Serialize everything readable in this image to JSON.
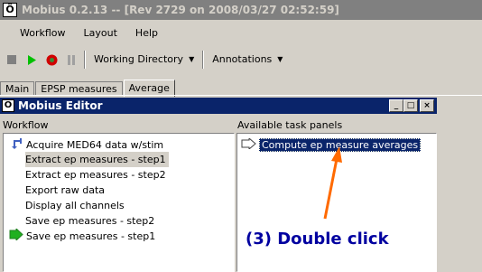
{
  "app": {
    "title": "Mobius 0.2.13 -- [Rev 2729 on 2008/03/27 02:52:59]",
    "icon_glyph": "Ö"
  },
  "menu": {
    "items": [
      "Workflow",
      "Layout",
      "Help"
    ]
  },
  "toolbar": {
    "buttons": [
      "stop-icon",
      "play-icon",
      "record-icon",
      "pause-icon"
    ],
    "working_directory": "Working Directory",
    "annotations": "Annotations"
  },
  "tabs": [
    "Main",
    "EPSP measures",
    "Average"
  ],
  "editor": {
    "title": "Mobius Editor",
    "icon_glyph": "Ö",
    "workflow_label": "Workflow",
    "task_panels_label": "Available task panels",
    "workflow_items": [
      "Acquire MED64 data w/stim",
      "Extract ep measures - step1",
      "Extract ep measures - step2",
      "Export raw data",
      "Display all channels",
      "Save ep measures - step2",
      "Save ep measures - step1"
    ],
    "task_panels": [
      "Compute ep measure averages"
    ]
  },
  "annotation": {
    "text": "(3) Double click",
    "color": "#ff6a00"
  },
  "colors": {
    "titlebar_active": "#0a246a",
    "titlebar_inactive": "#808080",
    "face": "#d4d0c8"
  }
}
